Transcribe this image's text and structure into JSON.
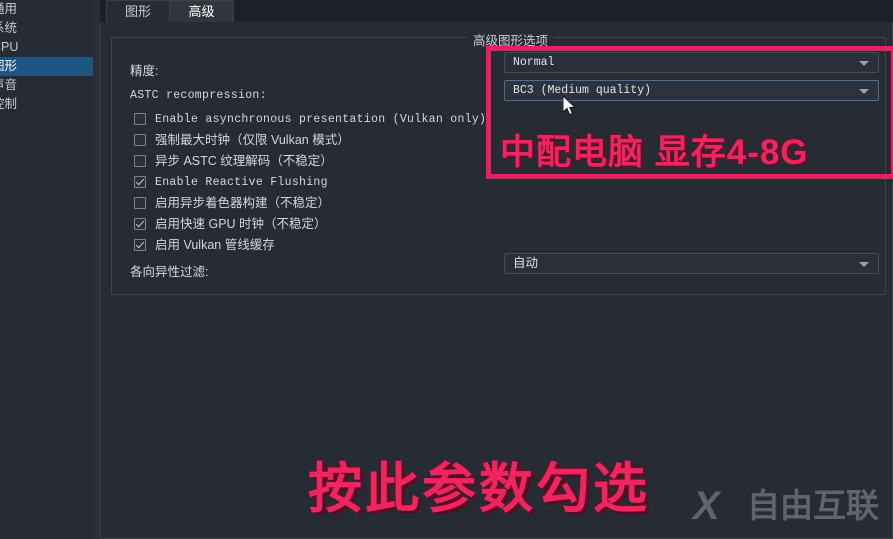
{
  "sidebar": {
    "items": [
      {
        "label": "通用",
        "selected": false
      },
      {
        "label": "系统",
        "selected": false
      },
      {
        "label": "CPU",
        "selected": false
      },
      {
        "label": "图形",
        "selected": true
      },
      {
        "label": "声音",
        "selected": false
      },
      {
        "label": "控制",
        "selected": false
      }
    ]
  },
  "tabs": [
    {
      "label": "图形",
      "active": false
    },
    {
      "label": "高级",
      "active": true
    }
  ],
  "group": {
    "title": "高级图形选项",
    "precision_label": "精度:",
    "precision_value": "Normal",
    "astc_label": "ASTC recompression:",
    "astc_value": "BC3 (Medium quality)",
    "aniso_label": "各向异性过滤:",
    "aniso_value": "自动",
    "checkboxes": [
      {
        "label": "Enable asynchronous presentation (Vulkan only)",
        "checked": false,
        "mono": true
      },
      {
        "label": "强制最大时钟（仅限 Vulkan 模式）",
        "checked": false,
        "mono": false
      },
      {
        "label": "异步 ASTC 纹理解码（不稳定）",
        "checked": false,
        "mono": false
      },
      {
        "label": "Enable Reactive Flushing",
        "checked": true,
        "mono": true
      },
      {
        "label": "启用异步着色器构建（不稳定）",
        "checked": false,
        "mono": false
      },
      {
        "label": "启用快速 GPU 时钟（不稳定）",
        "checked": true,
        "mono": false
      },
      {
        "label": "启用 Vulkan 管线缓存",
        "checked": true,
        "mono": false
      }
    ]
  },
  "annotations": {
    "redbox_text": "中配电脑  显存4-8G",
    "bottom_text": "按此参数勾选",
    "accent_color": "#f2245f",
    "redbox_border_color": "#ec1e5f"
  },
  "watermark": {
    "logo": "X",
    "text": "自由互联"
  }
}
